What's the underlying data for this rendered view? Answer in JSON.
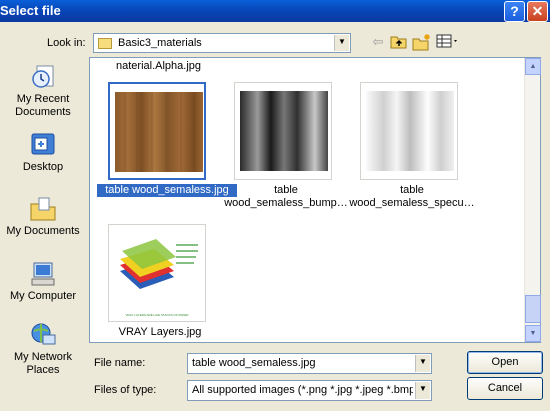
{
  "window": {
    "title": "Select file"
  },
  "titlebar": {
    "help_glyph": "?",
    "close_glyph": "✕"
  },
  "toolbar": {
    "lookin_label": "Look in:",
    "lookin_value": "Basic3_materials",
    "icons": [
      "back-arrow-icon",
      "up-folder-icon",
      "new-folder-icon",
      "view-menu-icon"
    ]
  },
  "places": [
    {
      "label": "My Recent Documents",
      "icon": "recent-documents-icon"
    },
    {
      "label": "Desktop",
      "icon": "desktop-icon"
    },
    {
      "label": "My Documents",
      "icon": "my-documents-icon"
    },
    {
      "label": "My Computer",
      "icon": "my-computer-icon"
    },
    {
      "label": "My Network Places",
      "icon": "network-places-icon"
    }
  ],
  "filelist": {
    "cut_item": "naterial.Alpha.jpg",
    "items": [
      {
        "line1": "table wood_semaless.jpg",
        "line2": "",
        "selected": true
      },
      {
        "line1": "table",
        "line2": "wood_semaless_bump…",
        "selected": false
      },
      {
        "line1": "table",
        "line2": "wood_semaless_specu…",
        "selected": false
      },
      {
        "line1": "VRAY Layers.jpg",
        "line2": "",
        "selected": false
      }
    ],
    "thumb_caption": "VRAY LAYERS ARE LIKE STACKS OF PAPER"
  },
  "footer": {
    "filename_label": "File name:",
    "filename_value": "table wood_semaless.jpg",
    "filetype_label": "Files of type:",
    "filetype_value": "All supported images (*.png *.jpg *.jpeg *.bmp *.",
    "open_label": "Open",
    "cancel_label": "Cancel"
  },
  "colors": {
    "selection": "#316ac5",
    "titlebar": "#0842b4",
    "dialog_bg": "#ece9d8"
  }
}
